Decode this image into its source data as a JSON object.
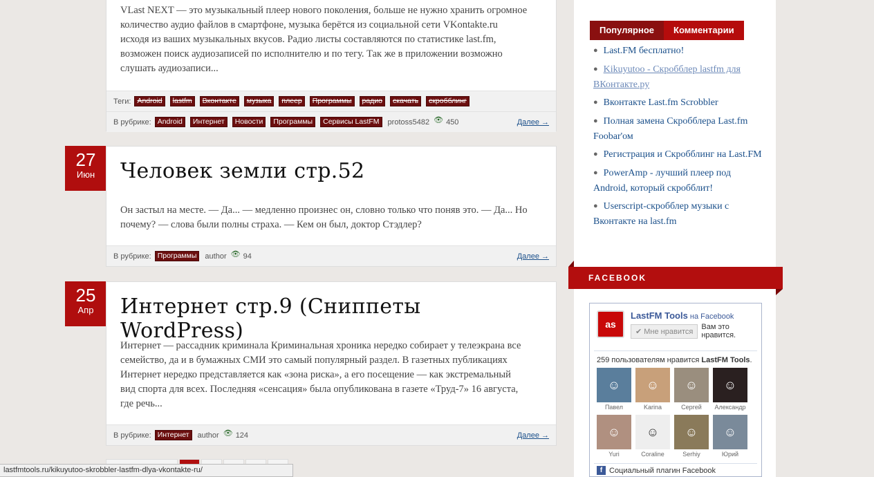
{
  "post1": {
    "excerpt": "VLast NEXT — это музыкальный плеер нового поколения, больше не нужно хранить огромное количество аудио файлов в смартфоне, музыка берётся из социальной сети VKontakte.ru исходя из ваших музыкальных вкусов. Радио листы составляются по статистике last.fm, возможен поиск аудиозаписей по исполнителю и по тегу. Так же в приложении возможно слушать аудиозаписи...",
    "tags_label": "Теги:",
    "tags": [
      "Android",
      "lastfm",
      "Вконтакте",
      "музыка",
      "плеер",
      "Программы",
      "радио",
      "скачать",
      "скробблинг"
    ],
    "category_label": "В рубрике:",
    "categories": [
      "Android",
      "Интернет",
      "Новости",
      "Программы",
      "Сервисы LastFM"
    ],
    "author": "protoss5482",
    "views": "450",
    "more": "Далее →"
  },
  "post2": {
    "day": "27",
    "month": "Июн",
    "title": "Человек земли стр.52",
    "excerpt": "Он застыл на месте. — Да... — медленно произнес он, словно только что поняв это. — Да... Но почему? — слова были полны страха. — Кем он был, доктор Стэдлер?",
    "category_label": "В рубрике:",
    "categories": [
      "Программы"
    ],
    "author": "author",
    "views": "94",
    "more": "Далее →"
  },
  "post3": {
    "day": "25",
    "month": "Апр",
    "title": "Интернет стр.9 (Сниппеты WordPress)",
    "excerpt": "Интернет — рассадник криминала Криминальная хроника нередко собирает у телеэкрана все семейство, да и в бумажных СМИ это самый популярный раздел. В газетных публикациях Интернет нередко представляется как «зона риска», а его посещение — как экстремальный вид спорта для всех. Последняя «сенсация» была опубликована в газете «Труд-7» 16 августа, где речь...",
    "category_label": "В рубрике:",
    "categories": [
      "Интернет"
    ],
    "author": "author",
    "views": "124",
    "more": "Далее →"
  },
  "sidebar": {
    "tabs": [
      "Популярное",
      "Комментарии"
    ],
    "popular": [
      "Last.FM бесплатно!",
      "Kikuyutoo - Скробблер lastfm для ВКонтакте.ру",
      "Вконтакте Last.fm Scrobbler",
      "Полная замена Скробблера Last.fm Foobar'ом",
      "Регистрация и Скробблинг на Last.FM",
      "PowerAmp - лучший плеер под Android, который скробблит!",
      "Userscript-скробблер музыки с Вконтакте на last.fm"
    ],
    "facebook_heading": "FACEBOOK"
  },
  "fb": {
    "page_name": "LastFM Tools",
    "on_facebook": "на Facebook",
    "like_button": "✔ Мне нравится",
    "likes_text_1": "Вам это",
    "likes_text_2": "нравится.",
    "count_text": "259 пользователям нравится",
    "count_name": "LastFM Tools",
    "faces": [
      "Павел",
      "Karina",
      "Сергей",
      "Александр",
      "Yuri",
      "Coraline",
      "Serhiy",
      "Юрий"
    ],
    "footer": "Социальный плагин Facebook"
  },
  "status_url": "lastfmtools.ru/kikuyutoo-skrobbler-lastfm-dlya-vkontakte-ru/"
}
